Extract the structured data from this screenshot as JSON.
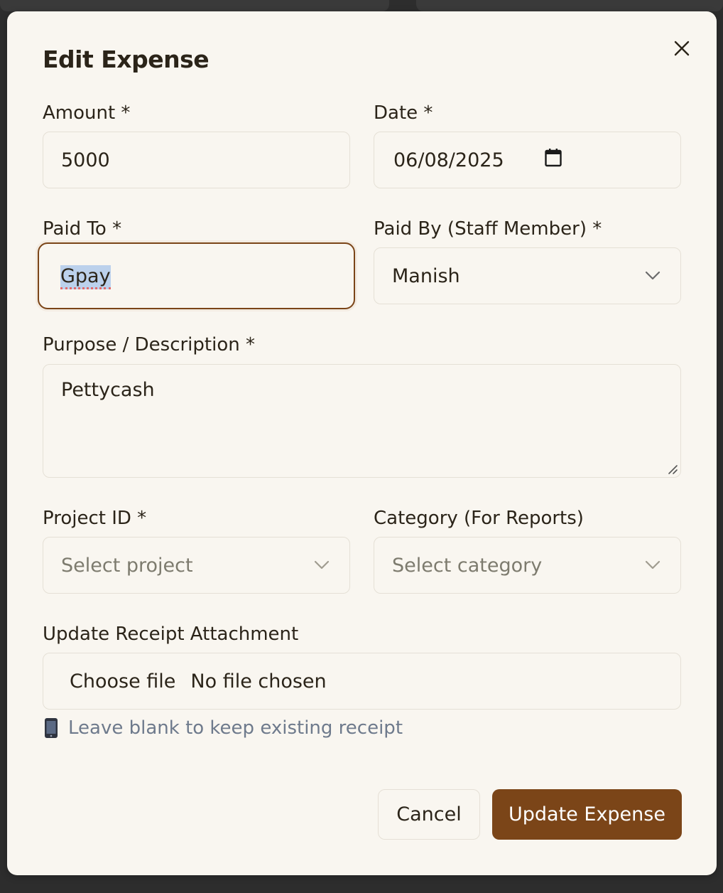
{
  "modal": {
    "title": "Edit Expense",
    "close_icon": "close-icon"
  },
  "amount": {
    "label": "Amount *",
    "value": "5000"
  },
  "date": {
    "label": "Date *",
    "value": "06/08/2025",
    "icon": "calendar-icon"
  },
  "paid_to": {
    "label": "Paid To *",
    "value": "Gpay",
    "focused": true
  },
  "paid_by": {
    "label": "Paid By (Staff Member) *",
    "value": "Manish",
    "icon": "chevron-down-icon"
  },
  "purpose": {
    "label": "Purpose / Description *",
    "value": "Pettycash"
  },
  "project": {
    "label": "Project ID *",
    "placeholder": "Select project",
    "icon": "chevron-down-icon"
  },
  "category": {
    "label": "Category (For Reports)",
    "placeholder": "Select category",
    "icon": "chevron-down-icon"
  },
  "receipt": {
    "label": "Update Receipt Attachment",
    "button": "Choose file",
    "status": "No file chosen",
    "hint": "Leave blank to keep existing receipt",
    "hint_icon": "mobile-phone-icon"
  },
  "actions": {
    "cancel": "Cancel",
    "submit": "Update Expense"
  },
  "colors": {
    "accent": "#7b4518",
    "background": "#f9f6f0",
    "border": "#e5e0d6",
    "hint_text": "#6e7a8c"
  }
}
